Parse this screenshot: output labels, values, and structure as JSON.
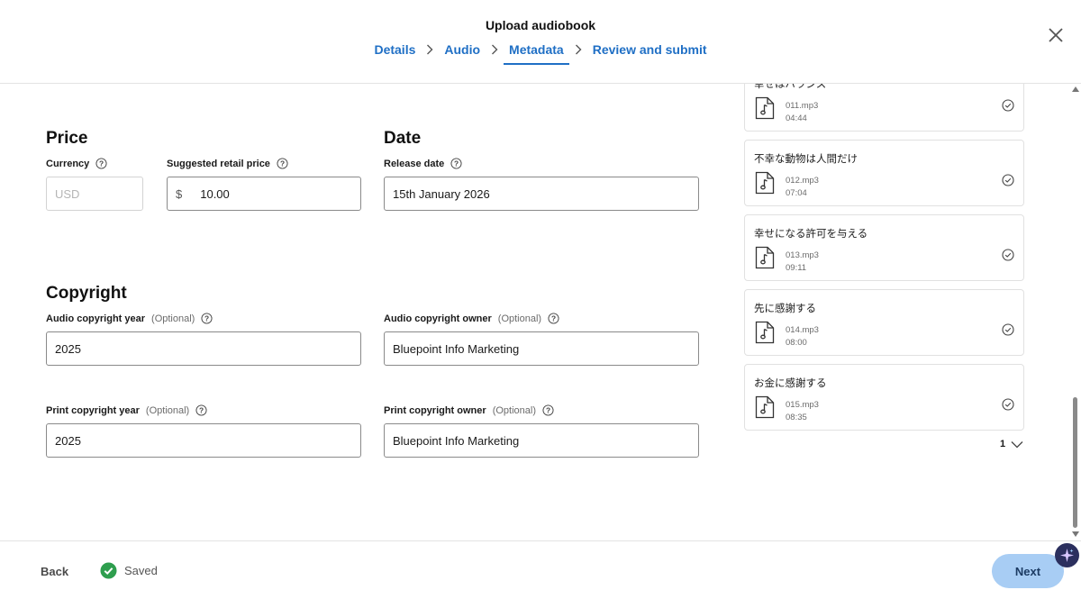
{
  "header": {
    "title": "Upload audiobook",
    "steps": [
      {
        "label": "Details"
      },
      {
        "label": "Audio"
      },
      {
        "label": "Metadata"
      },
      {
        "label": "Review and submit"
      }
    ],
    "active_step": "Metadata"
  },
  "price": {
    "title": "Price",
    "currency_label": "Currency",
    "currency_value": "USD",
    "srp_label": "Suggested retail price",
    "srp_prefix": "$",
    "srp_value": "10.00"
  },
  "date": {
    "title": "Date",
    "release_label": "Release date",
    "release_value": "15th January 2026"
  },
  "copyright": {
    "title": "Copyright",
    "optional": "(Optional)",
    "audio_year_label": "Audio copyright year",
    "audio_year_value": "2025",
    "audio_owner_label": "Audio copyright owner",
    "audio_owner_value": "Bluepoint Info Marketing",
    "print_year_label": "Print copyright year",
    "print_year_value": "2025",
    "print_owner_label": "Print copyright owner",
    "print_owner_value": "Bluepoint Info Marketing"
  },
  "tracks": [
    {
      "title": "幸せはバランス",
      "file": "011.mp3",
      "duration": "04:44"
    },
    {
      "title": "不幸な動物は人間だけ",
      "file": "012.mp3",
      "duration": "07:04"
    },
    {
      "title": "幸せになる許可を与える",
      "file": "013.mp3",
      "duration": "09:11"
    },
    {
      "title": "先に感謝する",
      "file": "014.mp3",
      "duration": "08:00"
    },
    {
      "title": "お金に感謝する",
      "file": "015.mp3",
      "duration": "08:35"
    }
  ],
  "pager": {
    "page": "1"
  },
  "footer": {
    "back_label": "Back",
    "saved_label": "Saved",
    "next_label": "Next"
  },
  "colors": {
    "accent": "#1f6fc5",
    "next_button": "#a8cdf4",
    "saved_green": "#2e9e4e"
  },
  "icons": {
    "close": "close-icon",
    "help": "help-icon",
    "file": "audio-file-icon",
    "check": "check-circle-icon",
    "saved": "check-badge-icon",
    "assistant": "sparkle-icon"
  }
}
